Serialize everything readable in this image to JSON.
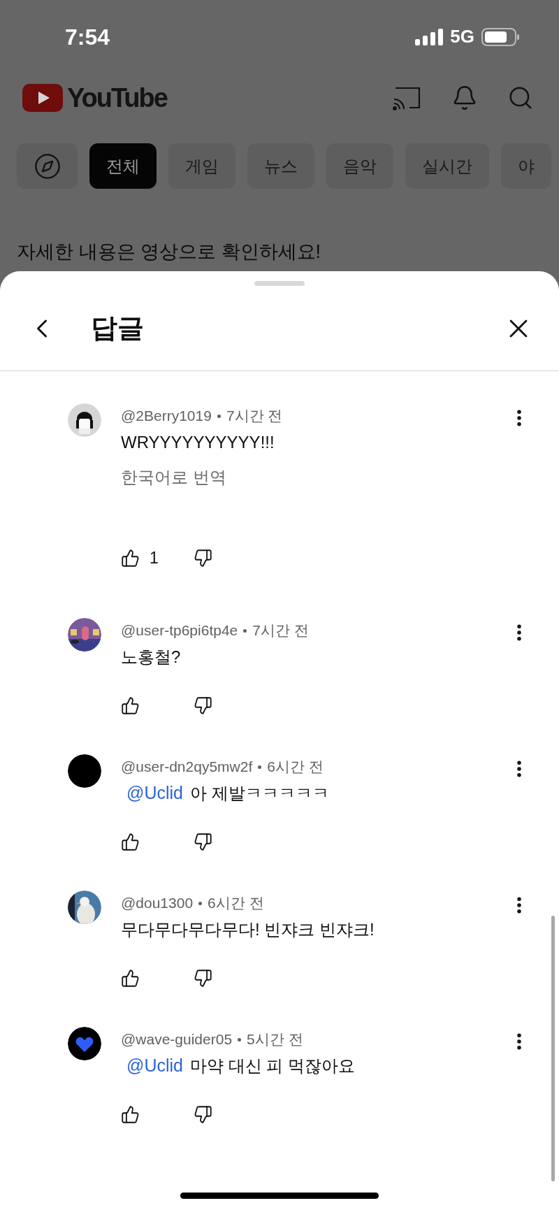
{
  "status_bar": {
    "time": "7:54",
    "network": "5G"
  },
  "header": {
    "logo_text": "YouTube"
  },
  "chips": [
    {
      "kind": "explore",
      "selected": false
    },
    {
      "kind": "label",
      "label": "전체",
      "selected": true
    },
    {
      "kind": "label",
      "label": "게임",
      "selected": false
    },
    {
      "kind": "label",
      "label": "뉴스",
      "selected": false
    },
    {
      "kind": "label",
      "label": "음악",
      "selected": false
    },
    {
      "kind": "label",
      "label": "실시간",
      "selected": false
    },
    {
      "kind": "label",
      "label": "야",
      "selected": false
    }
  ],
  "background_text": "자세한 내용은 영상으로 확인하세요!",
  "sheet": {
    "title": "답글"
  },
  "comments": [
    {
      "author": "@2Berry1019",
      "time": "7시간 전",
      "avatar": {
        "kind": "sketch"
      },
      "text": "WRYYYYYYYYYY!!!",
      "translate_link": "한국어로 번역",
      "likes": "1"
    },
    {
      "author": "@user-tp6pi6tp4e",
      "time": "7시간 전",
      "avatar": {
        "kind": "room"
      },
      "text": "노홍철?"
    },
    {
      "author": "@user-dn2qy5mw2f",
      "time": "6시간 전",
      "avatar": {
        "kind": "plain"
      },
      "mention": "@Uclid",
      "text": "아 제발ㅋㅋㅋㅋㅋ"
    },
    {
      "author": "@dou1300",
      "time": "6시간 전",
      "avatar": {
        "kind": "bird"
      },
      "text": "무다무다무다무다! 빈쟈크 빈쟈크!"
    },
    {
      "author": "@wave-guider05",
      "time": "5시간 전",
      "avatar": {
        "kind": "heart"
      },
      "mention": "@Uclid",
      "text": "마약 대신 피 먹잖아요"
    }
  ]
}
